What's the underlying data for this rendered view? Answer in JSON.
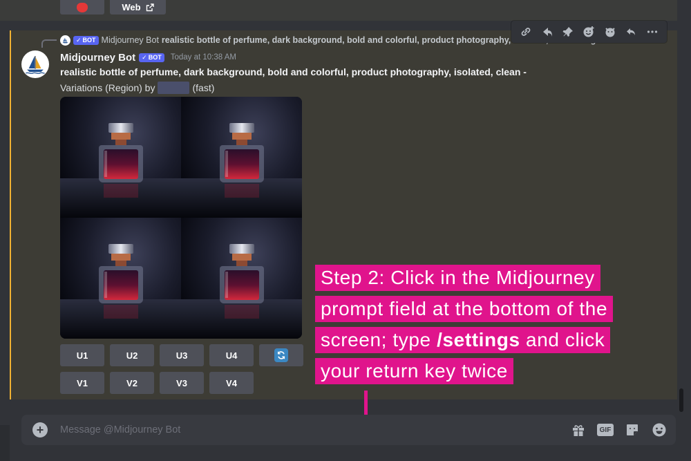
{
  "previous_message": {
    "web_button_label": "Web"
  },
  "reply": {
    "bot_name": "Midjourney Bot",
    "badge": "BOT",
    "text": "realistic bottle of perfume, dark background, bold and colorful, product photography, isolated, clean - Img"
  },
  "message": {
    "author": "Midjourney Bot",
    "badge": "BOT",
    "timestamp": "Today at 10:38 AM",
    "prompt": "realistic bottle of perfume, dark background, bold and colorful, product photography, isolated, clean -",
    "variation_prefix": "Variations (Region) by",
    "variation_suffix": "(fast)"
  },
  "toolbar": {
    "icons": [
      "link-icon",
      "forward-icon",
      "pin-icon",
      "add-reaction-icon",
      "app-icon",
      "reply-icon",
      "more-icon"
    ]
  },
  "upscale_buttons": [
    "U1",
    "U2",
    "U3",
    "U4"
  ],
  "variation_buttons": [
    "V1",
    "V2",
    "V3",
    "V4"
  ],
  "callout": {
    "line1": "Step 2: Click in the Midjourney",
    "line2": "prompt field at the bottom of the",
    "line3_before": "screen; type ",
    "line3_bold": "/settings",
    "line3_after": " and click",
    "line4": "your return key twice"
  },
  "composer": {
    "placeholder": "Message @Midjourney Bot",
    "gif_label": "GIF"
  },
  "colors": {
    "accent": "#e0148c",
    "badge": "#5865f2",
    "highlight_border": "#f0b232"
  }
}
